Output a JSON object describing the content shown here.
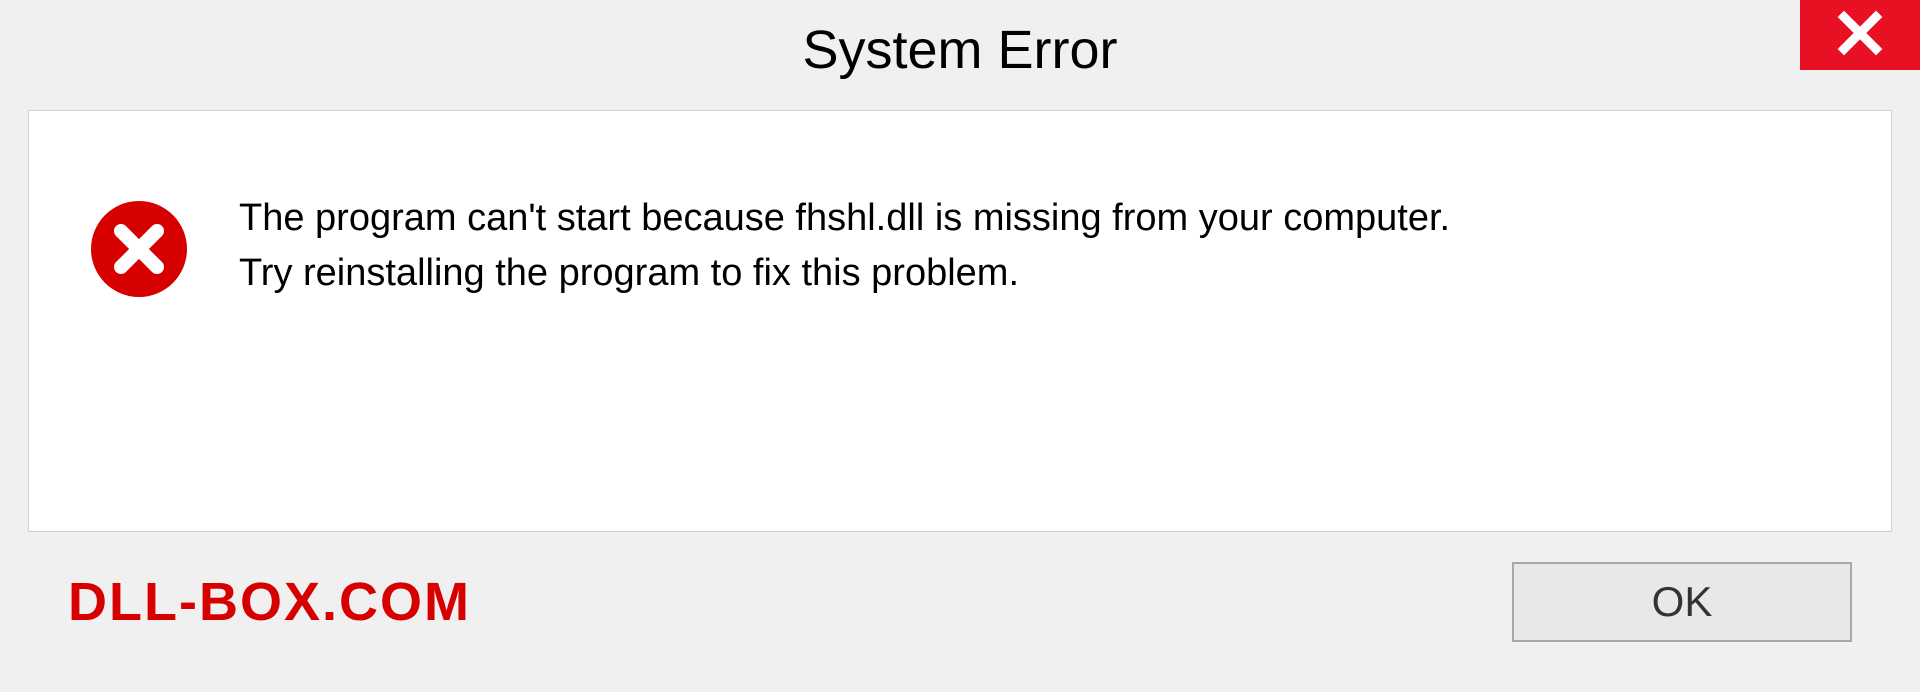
{
  "titlebar": {
    "title": "System Error"
  },
  "message": {
    "line1": "The program can't start because fhshl.dll is missing from your computer.",
    "line2": "Try reinstalling the program to fix this problem."
  },
  "footer": {
    "watermark": "DLL-BOX.COM",
    "ok_label": "OK"
  },
  "colors": {
    "close_bg": "#e81123",
    "error_icon": "#d60000",
    "watermark": "#d60000"
  }
}
